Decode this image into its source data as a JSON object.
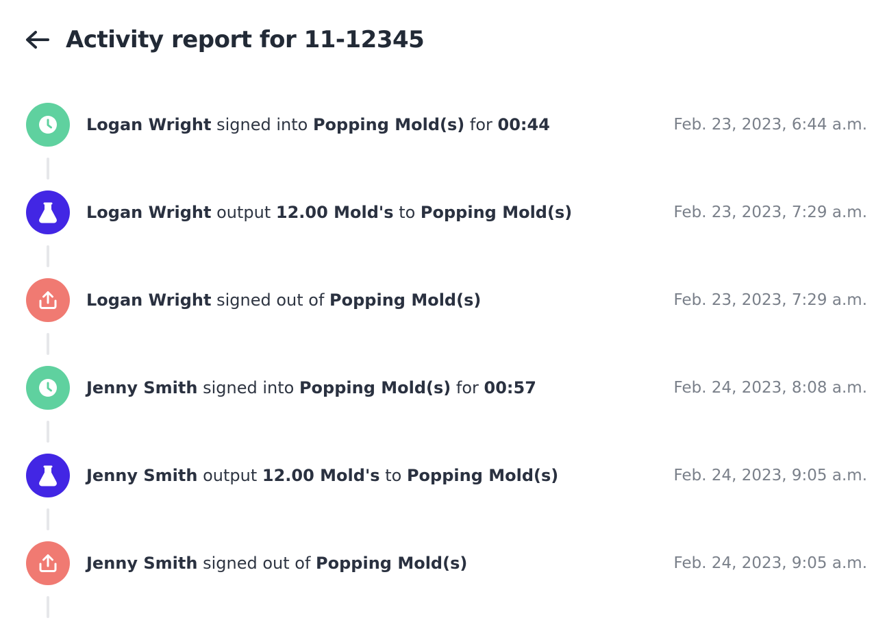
{
  "header": {
    "title": "Activity report for 11-12345",
    "back_icon": "arrow-left-icon"
  },
  "colors": {
    "clock": "#5fd19f",
    "flask": "#4226e4",
    "upload": "#f07a72",
    "rail": "#e6e7ea"
  },
  "events": [
    {
      "icon": "clock-icon",
      "user": "Logan Wright",
      "verb": " signed into ",
      "target": "Popping Mold(s)",
      "suffix": " for ",
      "extra": "00:44",
      "time": "Feb. 23, 2023, 6:44 a.m."
    },
    {
      "icon": "flask-icon",
      "user": "Logan Wright",
      "verb": " output ",
      "qty": "12.00 Mold's",
      "mid": " to ",
      "target": "Popping Mold(s)",
      "time": "Feb. 23, 2023, 7:29 a.m."
    },
    {
      "icon": "upload-icon",
      "user": "Logan Wright",
      "verb": " signed out of ",
      "target": "Popping Mold(s)",
      "time": "Feb. 23, 2023, 7:29 a.m."
    },
    {
      "icon": "clock-icon",
      "user": "Jenny Smith",
      "verb": " signed into ",
      "target": "Popping Mold(s)",
      "suffix": " for ",
      "extra": "00:57",
      "time": "Feb. 24, 2023, 8:08 a.m."
    },
    {
      "icon": "flask-icon",
      "user": "Jenny Smith",
      "verb": " output ",
      "qty": "12.00 Mold's",
      "mid": " to ",
      "target": "Popping Mold(s)",
      "time": "Feb. 24, 2023, 9:05 a.m."
    },
    {
      "icon": "upload-icon",
      "user": "Jenny Smith",
      "verb": " signed out of ",
      "target": "Popping Mold(s)",
      "time": "Feb. 24, 2023, 9:05 a.m."
    }
  ]
}
